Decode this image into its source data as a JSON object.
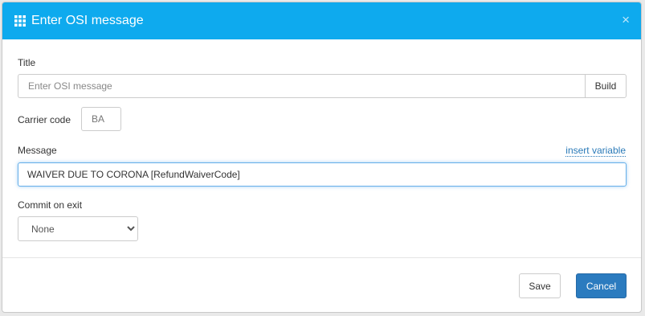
{
  "dialog": {
    "title": "Enter OSI message",
    "close_glyph": "×",
    "header_color": "#0eaaee"
  },
  "form": {
    "title_label": "Title",
    "title_placeholder": "Enter OSI message",
    "build_label": "Build",
    "carrier_label": "Carrier code",
    "carrier_placeholder": "BA",
    "message_label": "Message",
    "insert_variable_label": "insert variable",
    "message_value": "WAIVER DUE TO CORONA [RefundWaiverCode]",
    "commit_label": "Commit on exit",
    "commit_selected": "None"
  },
  "footer": {
    "save_label": "Save",
    "cancel_label": "Cancel",
    "cancel_color": "#2b7bbf"
  }
}
